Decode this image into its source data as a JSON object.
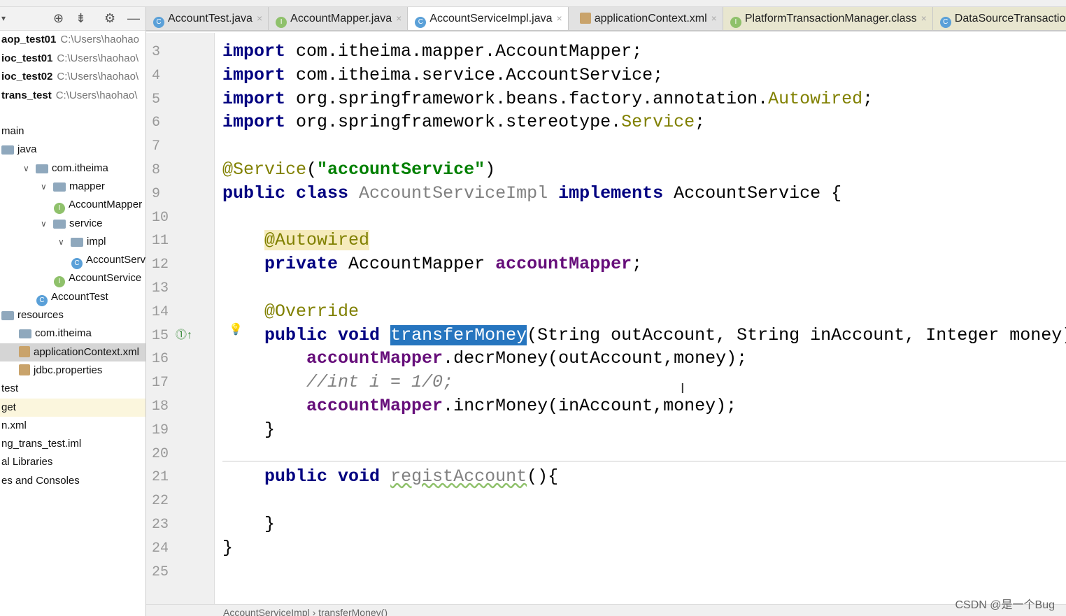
{
  "sidebar": {
    "projects": [
      {
        "name": "aop_test01",
        "path": "C:\\Users\\haohao"
      },
      {
        "name": "ioc_test01",
        "path": "C:\\Users\\haohao\\"
      },
      {
        "name": "ioc_test02",
        "path": "C:\\Users\\haohao\\"
      },
      {
        "name": "trans_test",
        "path": "C:\\Users\\haohao\\"
      }
    ],
    "tree": [
      {
        "label": "main",
        "indent": 0,
        "icon": "none"
      },
      {
        "label": "java",
        "indent": 0,
        "icon": "folder-icon"
      },
      {
        "label": "com.itheima",
        "indent": 1,
        "icon": "folder-icon",
        "fold": "v"
      },
      {
        "label": "mapper",
        "indent": 2,
        "icon": "folder-icon",
        "fold": "v"
      },
      {
        "label": "AccountMapper",
        "indent": 3,
        "icon": "interface-icon"
      },
      {
        "label": "service",
        "indent": 2,
        "icon": "folder-icon",
        "fold": "v"
      },
      {
        "label": "impl",
        "indent": 3,
        "icon": "folder-icon",
        "fold": "v"
      },
      {
        "label": "AccountServiceImpl",
        "indent": 4,
        "icon": "class-icon"
      },
      {
        "label": "AccountService",
        "indent": 3,
        "icon": "interface-icon"
      },
      {
        "label": "AccountTest",
        "indent": 2,
        "icon": "class-icon"
      },
      {
        "label": "resources",
        "indent": 0,
        "icon": "folder-icon"
      },
      {
        "label": "com.itheima",
        "indent": 1,
        "icon": "folder-icon"
      },
      {
        "label": "applicationContext.xml",
        "indent": 1,
        "icon": "xml-icon",
        "state": "selected"
      },
      {
        "label": "jdbc.properties",
        "indent": 1,
        "icon": "properties-icon"
      },
      {
        "label": "test",
        "indent": 0,
        "icon": "none"
      },
      {
        "label": "get",
        "indent": 0,
        "icon": "none",
        "state": "highlight"
      },
      {
        "label": "n.xml",
        "indent": 0,
        "icon": "none"
      },
      {
        "label": "ng_trans_test.iml",
        "indent": 0,
        "icon": "none"
      },
      {
        "label": "al Libraries",
        "indent": 0,
        "icon": "none"
      },
      {
        "label": "es and Consoles",
        "indent": 0,
        "icon": "none"
      }
    ]
  },
  "tabs": [
    {
      "label": "AccountTest.java",
      "icon": "class-icon"
    },
    {
      "label": "AccountMapper.java",
      "icon": "interface-icon"
    },
    {
      "label": "AccountServiceImpl.java",
      "icon": "class-icon",
      "active": true
    },
    {
      "label": "applicationContext.xml",
      "icon": "xml-icon"
    },
    {
      "label": "PlatformTransactionManager.class",
      "icon": "interface-icon",
      "lib": true
    },
    {
      "label": "DataSourceTransactionManager.class",
      "icon": "class-icon",
      "lib": true
    }
  ],
  "code": [
    {
      "n": "3",
      "t": [
        [
          "import",
          "kw"
        ],
        [
          " com.itheima.mapper.AccountMapper;",
          ""
        ]
      ]
    },
    {
      "n": "4",
      "t": [
        [
          "import",
          "kw"
        ],
        [
          " com.itheima.service.AccountService;",
          ""
        ]
      ]
    },
    {
      "n": "5",
      "t": [
        [
          "import",
          "kw"
        ],
        [
          " org.springframework.beans.factory.annotation.",
          ""
        ],
        [
          "Autowired",
          "an"
        ],
        [
          ";",
          ""
        ]
      ]
    },
    {
      "n": "6",
      "t": [
        [
          "import",
          "kw"
        ],
        [
          " org.springframework.stereotype.",
          ""
        ],
        [
          "Service",
          "an"
        ],
        [
          ";",
          ""
        ]
      ]
    },
    {
      "n": "7",
      "t": []
    },
    {
      "n": "8",
      "t": [
        [
          "@Service",
          "an"
        ],
        [
          "(",
          ""
        ],
        [
          "\"accountService\"",
          "str"
        ],
        [
          ")",
          ""
        ]
      ]
    },
    {
      "n": "9",
      "t": [
        [
          "public class",
          "kw"
        ],
        [
          " ",
          ""
        ],
        [
          "AccountServiceImpl",
          "unused"
        ],
        [
          " ",
          ""
        ],
        [
          "implements",
          "kw"
        ],
        [
          " AccountService {",
          ""
        ]
      ]
    },
    {
      "n": "10",
      "t": []
    },
    {
      "n": "11",
      "t": [
        [
          "    ",
          ""
        ],
        [
          "@Autowired",
          "annbg"
        ]
      ]
    },
    {
      "n": "12",
      "t": [
        [
          "    ",
          ""
        ],
        [
          "private",
          "kw"
        ],
        [
          " AccountMapper ",
          ""
        ],
        [
          "accountMapper",
          "fld"
        ],
        [
          ";",
          ""
        ]
      ]
    },
    {
      "n": "13",
      "t": []
    },
    {
      "n": "14",
      "t": [
        [
          "    ",
          ""
        ],
        [
          "@Override",
          "an"
        ]
      ]
    },
    {
      "n": "15",
      "t": [
        [
          "    ",
          ""
        ],
        [
          "public void",
          "kw"
        ],
        [
          " ",
          ""
        ],
        [
          "transferMoney",
          "selw"
        ],
        [
          "(String outAccount, String inAccount, Integer money)",
          ""
        ]
      ]
    },
    {
      "n": "16",
      "t": [
        [
          "        ",
          ""
        ],
        [
          "accountMapper",
          "fld"
        ],
        [
          ".decrMoney(outAccount,money);",
          ""
        ]
      ]
    },
    {
      "n": "17",
      "t": [
        [
          "        ",
          ""
        ],
        [
          "//int i = 1/0;",
          "cm"
        ]
      ]
    },
    {
      "n": "18",
      "t": [
        [
          "        ",
          ""
        ],
        [
          "accountMapper",
          "fld"
        ],
        [
          ".incrMoney(inAccount,money);",
          ""
        ]
      ]
    },
    {
      "n": "19",
      "t": [
        [
          "    }",
          ""
        ]
      ]
    },
    {
      "n": "20",
      "t": []
    },
    {
      "n": "21",
      "t": [
        [
          "    ",
          ""
        ],
        [
          "public void",
          "kw"
        ],
        [
          " ",
          ""
        ],
        [
          "registAccount",
          "squig"
        ],
        [
          "(){",
          ""
        ]
      ]
    },
    {
      "n": "22",
      "t": []
    },
    {
      "n": "23",
      "t": [
        [
          "    }",
          ""
        ]
      ]
    },
    {
      "n": "24",
      "t": [
        [
          "}",
          ""
        ]
      ]
    },
    {
      "n": "25",
      "t": []
    }
  ],
  "breadcrumb": [
    "AccountServiceImpl",
    "transferMoney()"
  ],
  "watermark": "CSDN @是一个Bug"
}
